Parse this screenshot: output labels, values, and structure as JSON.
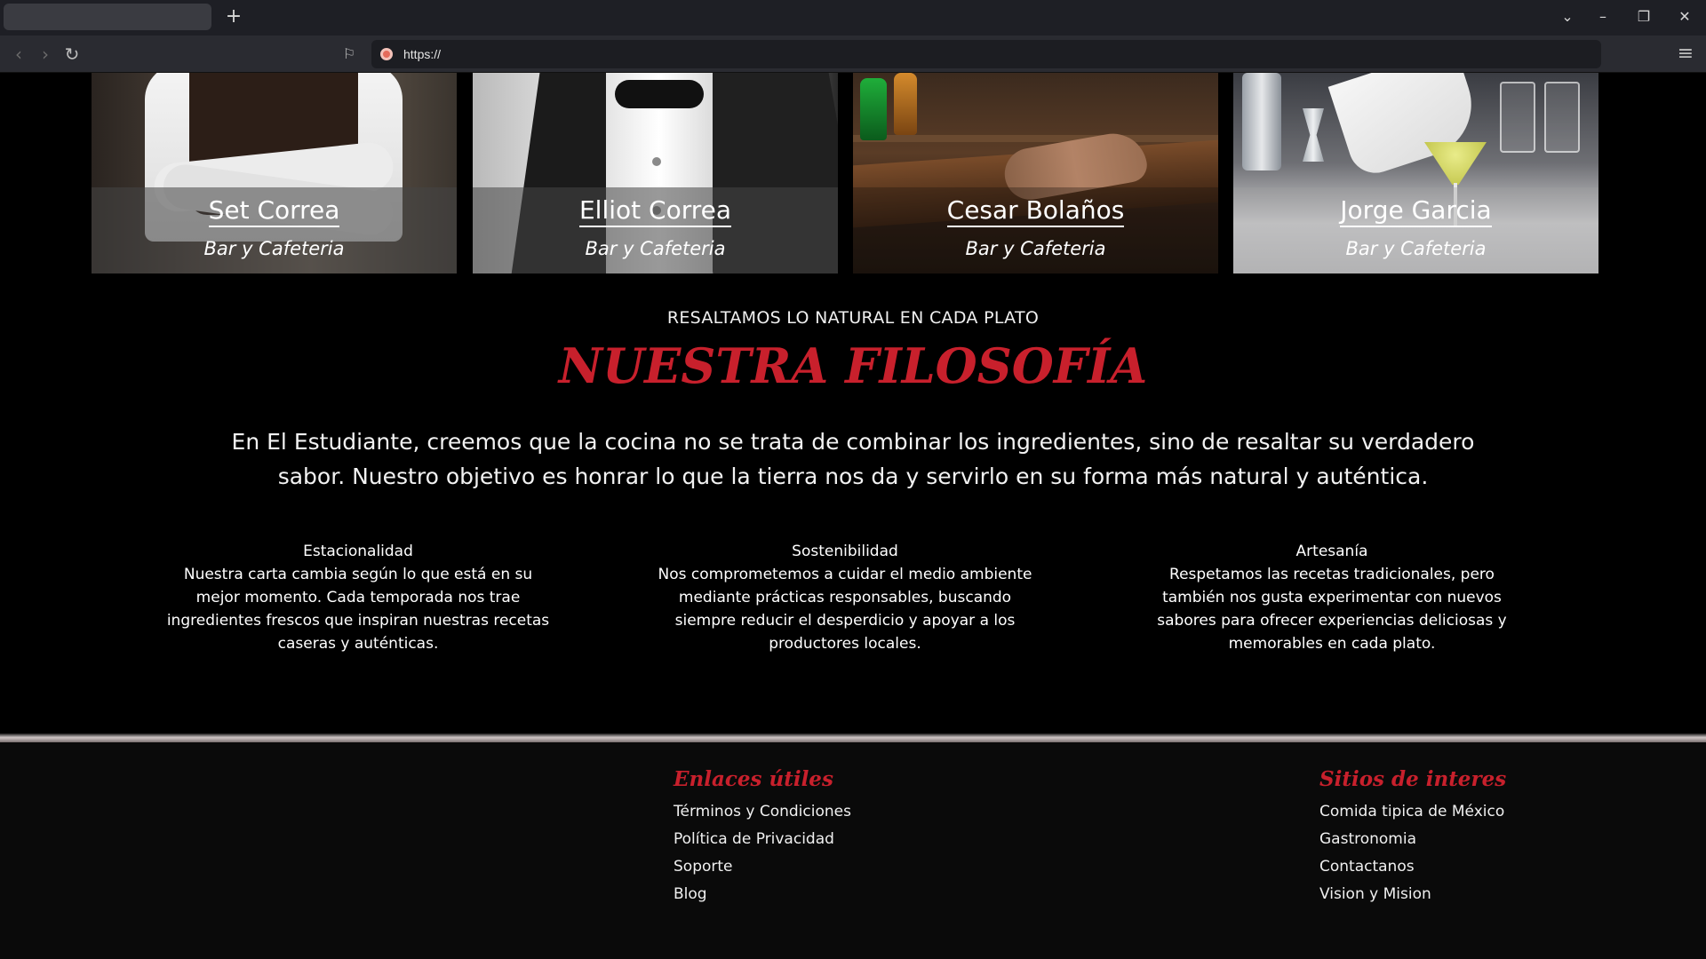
{
  "browser": {
    "url": "https://",
    "new_tab_symbol": "+",
    "controls": {
      "tab_list": "⌄",
      "minimize": "–",
      "restore": "❐",
      "close": "✕",
      "back": "‹",
      "forward": "›",
      "reload": "↻",
      "bookmark": "⚐",
      "menu": "≡"
    }
  },
  "team": [
    {
      "name": "Set Correa",
      "role": "Bar y Cafeteria"
    },
    {
      "name": "Elliot Correa",
      "role": "Bar y Cafeteria"
    },
    {
      "name": "Cesar Bolaños",
      "role": "Bar y Cafeteria"
    },
    {
      "name": "Jorge Garcia",
      "role": "Bar y Cafeteria"
    }
  ],
  "philosophy": {
    "subtitle": "RESALTAMOS LO NATURAL EN CADA PLATO",
    "title": "NUESTRA FILOSOFÍA",
    "text": "En El Estudiante, creemos que la cocina no se trata de combinar los ingredientes, sino de resaltar su verdadero sabor. Nuestro objetivo es honrar lo que la tierra nos da y servirlo en su forma más natural y auténtica.",
    "features": [
      {
        "title": "Estacionalidad",
        "text": "Nuestra carta cambia según lo que está en su mejor momento. Cada temporada nos trae ingredientes frescos que inspiran nuestras recetas caseras y auténticas."
      },
      {
        "title": "Sostenibilidad",
        "text": "Nos comprometemos a cuidar el medio ambiente mediante prácticas responsables, buscando siempre reducir el desperdicio y apoyar a los productores locales."
      },
      {
        "title": "Artesanía",
        "text": "Respetamos las recetas tradicionales, pero también nos gusta experimentar con nuevos sabores para ofrecer experiencias deliciosas y memorables en cada plato."
      }
    ]
  },
  "footer": {
    "useful_links": {
      "heading": "Enlaces útiles",
      "links": [
        "Términos y Condiciones",
        "Política de Privacidad",
        "Soporte",
        "Blog"
      ]
    },
    "sites": {
      "heading": "Sitios de interes",
      "links": [
        "Comida tipica de México",
        "Gastronomia",
        "Contactanos",
        "Vision y Mision"
      ]
    }
  },
  "colors": {
    "accent": "#c8202c",
    "background": "#000000",
    "footer_bg": "#0a0a0a"
  }
}
